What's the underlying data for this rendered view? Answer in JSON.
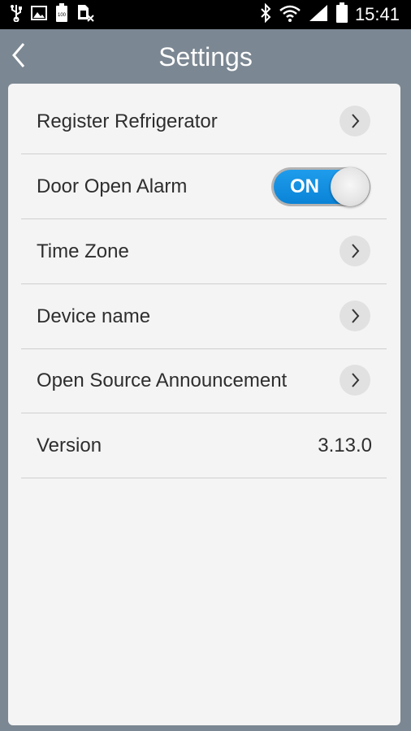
{
  "status_bar": {
    "time": "15:41",
    "battery_text": "100",
    "icons": [
      "usb-icon",
      "image-icon",
      "battery-saver-icon",
      "no-sim-icon",
      "bluetooth-icon",
      "wifi-icon",
      "signal-icon",
      "battery-icon"
    ]
  },
  "header": {
    "title": "Settings",
    "back_icon": "chevron-left-icon"
  },
  "settings": {
    "register": {
      "label": "Register Refrigerator"
    },
    "door_alarm": {
      "label": "Door Open Alarm",
      "toggle_text": "ON",
      "enabled": true
    },
    "time_zone": {
      "label": "Time Zone"
    },
    "device_name": {
      "label": "Device name"
    },
    "open_source": {
      "label": "Open Source Announcement"
    },
    "version": {
      "label": "Version",
      "value": "3.13.0"
    }
  },
  "colors": {
    "header_bg": "#7b8792",
    "toggle_on": "#1a96e6",
    "card_bg": "#f4f4f4"
  }
}
